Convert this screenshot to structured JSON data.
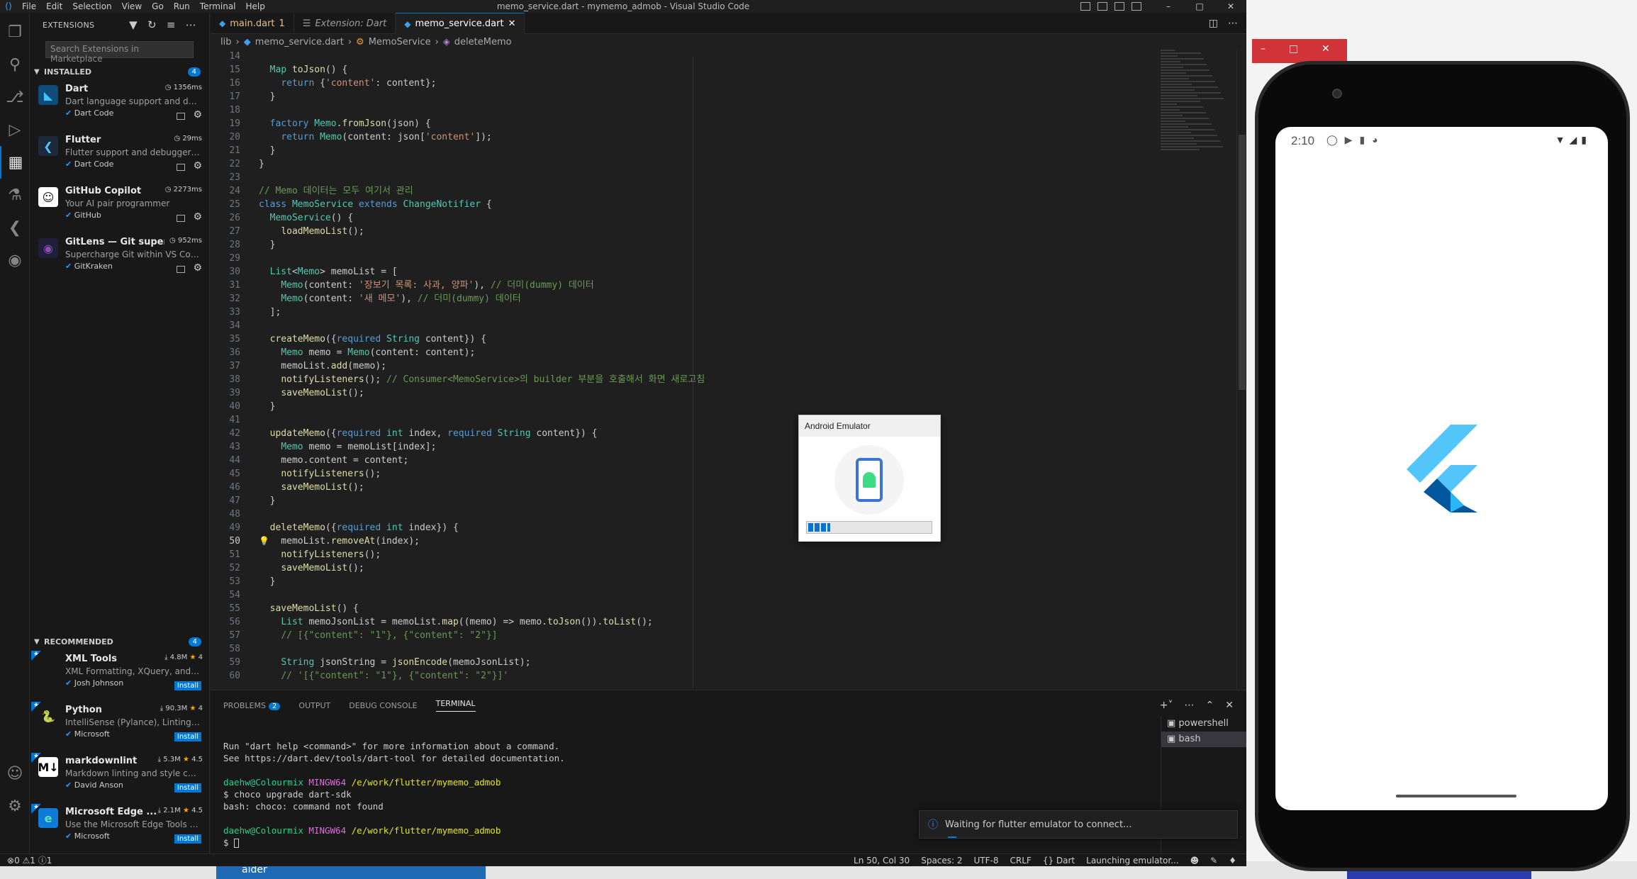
{
  "vscode": {
    "menu": [
      "File",
      "Edit",
      "Selection",
      "View",
      "Go",
      "Run",
      "Terminal",
      "Help"
    ],
    "window_title": "memo_service.dart - mymemo_admob - Visual Studio Code",
    "tabs": [
      {
        "label": "main.dart",
        "badge": "1"
      },
      {
        "label": "Extension: Dart"
      },
      {
        "label": "memo_service.dart"
      }
    ],
    "breadcrumb": [
      "lib",
      "memo_service.dart",
      "MemoService",
      "deleteMemo"
    ],
    "sidebar": {
      "title": "EXTENSIONS",
      "search_placeholder": "Search Extensions in Marketplace",
      "installed_label": "INSTALLED",
      "installed_count": "4",
      "recommended_label": "RECOMMENDED",
      "recommended_count": "4",
      "installed": [
        {
          "name": "Dart",
          "meta": "1356ms",
          "desc": "Dart language support and de...",
          "publisher": "Dart Code"
        },
        {
          "name": "Flutter",
          "meta": "29ms",
          "desc": "Flutter support and debugger f...",
          "publisher": "Dart Code"
        },
        {
          "name": "GitHub Copilot",
          "meta": "2273ms",
          "desc": "Your AI pair programmer",
          "publisher": "GitHub"
        },
        {
          "name": "GitLens — Git superc...",
          "meta": "952ms",
          "desc": "Supercharge Git within VS Cod...",
          "publisher": "GitKraken"
        }
      ],
      "recommended": [
        {
          "name": "XML Tools",
          "downloads": "4.8M",
          "rating": "4",
          "desc": "XML Formatting, XQuery, and X...",
          "publisher": "Josh Johnson",
          "action": "Install"
        },
        {
          "name": "Python",
          "downloads": "90.3M",
          "rating": "4",
          "desc": "IntelliSense (Pylance), Linting, ...",
          "publisher": "Microsoft",
          "action": "Install"
        },
        {
          "name": "markdownlint",
          "downloads": "5.3M",
          "rating": "4.5",
          "desc": "Markdown linting and style che...",
          "publisher": "David Anson",
          "action": "Install"
        },
        {
          "name": "Microsoft Edge ...",
          "downloads": "2.1M",
          "rating": "4.5",
          "desc": "Use the Microsoft Edge Tools fr...",
          "publisher": "Microsoft",
          "action": "Install"
        }
      ]
    },
    "code": {
      "first_line": 14,
      "current_line": 50,
      "lines": [
        "",
        "  Map toJson() {",
        "    return {'content': content};",
        "  }",
        "",
        "  factory Memo.fromJson(json) {",
        "    return Memo(content: json['content']);",
        "  }",
        "}",
        "",
        "// Memo 데이터는 모두 여기서 관리",
        "class MemoService extends ChangeNotifier {",
        "  MemoService() {",
        "    loadMemoList();",
        "  }",
        "",
        "  List<Memo> memoList = [",
        "    Memo(content: '장보기 목록: 사과, 양파'), // 더미(dummy) 데이터",
        "    Memo(content: '새 메모'), // 더미(dummy) 데이터",
        "  ];",
        "",
        "  createMemo({required String content}) {",
        "    Memo memo = Memo(content: content);",
        "    memoList.add(memo);",
        "    notifyListeners(); // Consumer<MemoService>의 builder 부분을 호출해서 화면 새로고침",
        "    saveMemoList();",
        "  }",
        "",
        "  updateMemo({required int index, required String content}) {",
        "    Memo memo = memoList[index];",
        "    memo.content = content;",
        "    notifyListeners();",
        "    saveMemoList();",
        "  }",
        "",
        "  deleteMemo({required int index}) {",
        "    memoList.removeAt(index);",
        "    notifyListeners();",
        "    saveMemoList();",
        "  }",
        "",
        "  saveMemoList() {",
        "    List memoJsonList = memoList.map((memo) => memo.toJson()).toList();",
        "    // [{\"content\": \"1\"}, {\"content\": \"2\"}]",
        "",
        "    String jsonString = jsonEncode(memoJsonList);",
        "    // '[{\"content\": \"1\"}, {\"content\": \"2\"}]'"
      ]
    },
    "panel": {
      "tabs": [
        "PROBLEMS",
        "OUTPUT",
        "DEBUG CONSOLE",
        "TERMINAL"
      ],
      "problems_count": "2",
      "active_tab": "TERMINAL",
      "terminal_lines": [
        {
          "text": "Run \"dart help <command>\" for more information about a command."
        },
        {
          "text": "See https://dart.dev/tools/dart-tool for detailed documentation."
        },
        {
          "text": ""
        },
        {
          "user": "daehw@Colourmix",
          "host": "MINGW64",
          "path": "/e/work/flutter/mymemo_admob"
        },
        {
          "text": "$ choco upgrade dart-sdk"
        },
        {
          "text": "bash: choco: command not found"
        },
        {
          "text": ""
        },
        {
          "user": "daehw@Colourmix",
          "host": "MINGW64",
          "path": "/e/work/flutter/mymemo_admob"
        },
        {
          "text": "$ "
        }
      ],
      "terminals": [
        "powershell",
        "bash"
      ]
    },
    "notification": "Waiting for flutter emulator to connect...",
    "statusbar": {
      "errors": "0",
      "warnings": "1",
      "info": "1",
      "position": "Ln 50, Col 30",
      "spaces": "Spaces: 2",
      "encoding": "UTF-8",
      "eol": "CRLF",
      "language": "Dart",
      "status": "Launching emulator..."
    }
  },
  "emulator_dialog": {
    "title": "Android Emulator",
    "progress": 0.18
  },
  "phone": {
    "time": "2:10"
  },
  "taskbar": {
    "item": "aider"
  },
  "colors": {
    "accent": "#0078d4",
    "flutter_light": "#54c5f8",
    "flutter_dark": "#01579b",
    "emulator_window": "#d13438"
  }
}
